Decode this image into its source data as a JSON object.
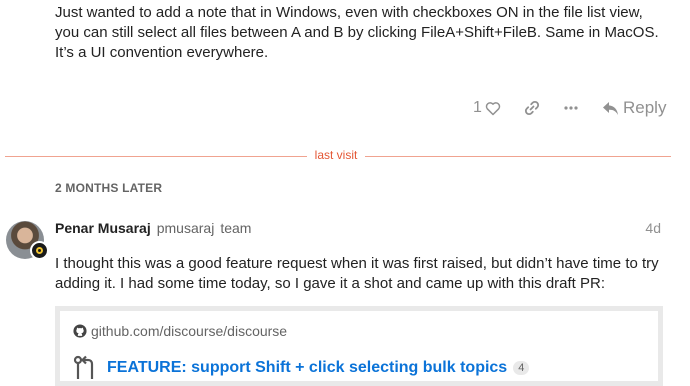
{
  "previous_post": {
    "body": "Just wanted to add a note that in Windows, even with checkboxes ON in the file list view, you can still select all files between A and B by clicking FileA+Shift+FileB. Same in MacOS. It’s a UI convention everywhere.",
    "like_count": "1",
    "reply_label": "Reply"
  },
  "last_visit": {
    "label": "last visit"
  },
  "time_gap": {
    "label": "2 MONTHS LATER"
  },
  "post": {
    "author_name": "Penar Musaraj",
    "username": "pmusaraj",
    "user_title": "team",
    "date": "4d",
    "body": "I thought this was a good feature request when it was first raised, but didn’t have time to try adding it. I had some time today, so I gave it a shot and came up with this draft PR:",
    "onebox": {
      "source": "github.com/discourse/discourse",
      "title": "FEATURE: support Shift + click selecting bulk topics",
      "badge": "4"
    }
  },
  "colors": {
    "accent": "#e45735",
    "link": "#0b73d8",
    "muted": "#919191"
  }
}
